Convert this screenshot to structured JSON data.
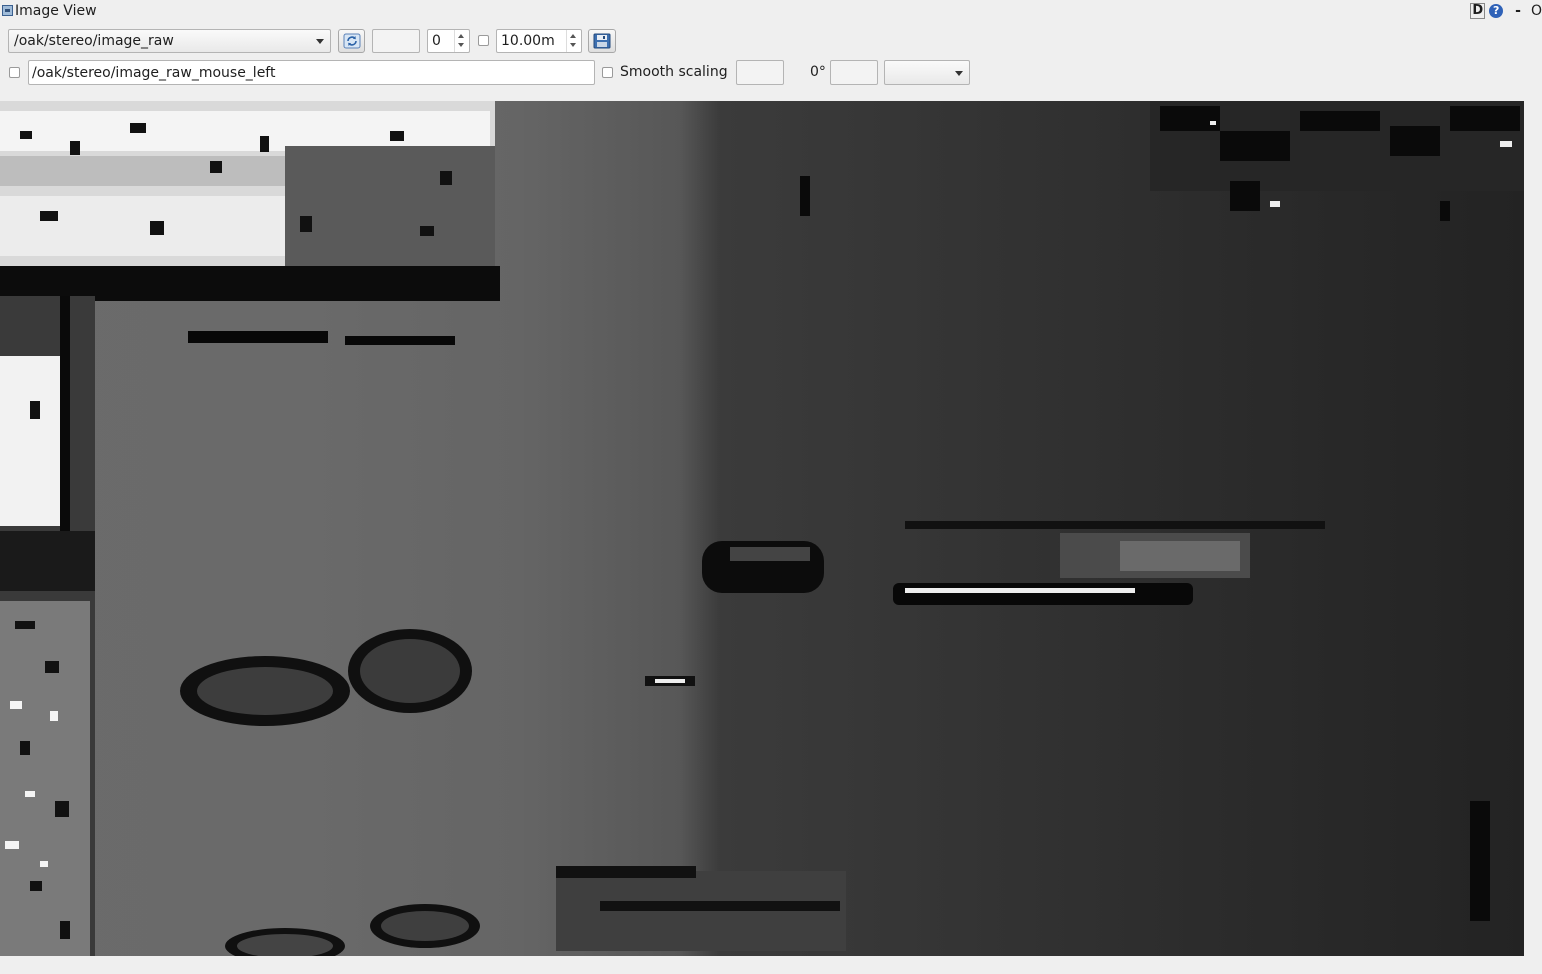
{
  "window": {
    "title": "Image View",
    "help_d": "D",
    "help_q": "?",
    "minimize": "-",
    "close": "O"
  },
  "toolbar": {
    "topic": "/oak/stereo/image_raw",
    "min_value": "0",
    "max_value": "10.00m",
    "mouse_topic": "/oak/stereo/image_raw_mouse_left",
    "smooth_scaling_label": "Smooth scaling",
    "rotation": "0°",
    "icons": {
      "refresh": "refresh-icon",
      "save": "save-icon"
    }
  },
  "image": {
    "description_type": "depth-image"
  }
}
